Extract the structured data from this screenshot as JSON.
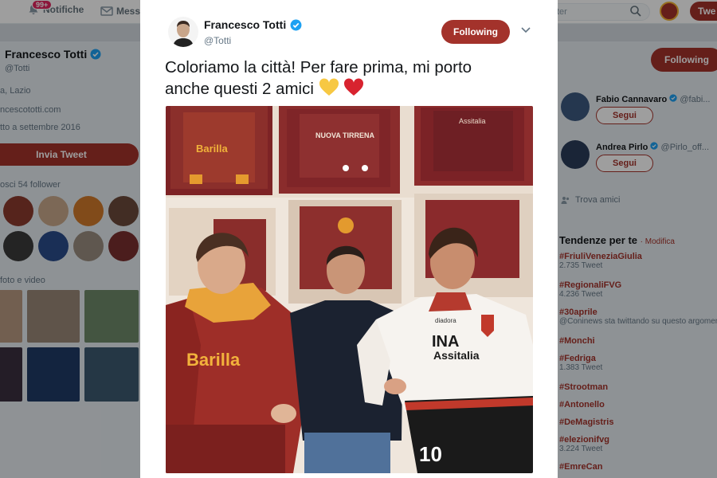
{
  "topbar": {
    "notifications_badge": "99+",
    "notifications_label": "Notifiche",
    "messages_label": "Messa",
    "search_placeholder": "ter",
    "tweet_button": "Twe"
  },
  "profile": {
    "name": "Francesco Totti",
    "handle": "@Totti",
    "location": "a, Lazio",
    "website": "ncescototti.com",
    "joined": "tto a settembre 2016",
    "tweet_button": "Invia Tweet",
    "followers_known": "osci 54 follower",
    "media_label": "foto e video",
    "follow_button": "Following"
  },
  "who_to_follow": [
    {
      "name": "Fabio Cannavaro",
      "handle": "@fabi...",
      "button": "Segui"
    },
    {
      "name": "Andrea Pirlo",
      "handle": "@Pirlo_off...",
      "button": "Segui"
    }
  ],
  "find_friends": "Trova amici",
  "trends": {
    "title": "Tendenze per te",
    "modify": "· Modifica",
    "items": [
      {
        "name": "#FriuliVeneziaGiulia",
        "count": "2.735 Tweet"
      },
      {
        "name": "#RegionaliFVG",
        "count": "4.236 Tweet"
      },
      {
        "name": "#30aprile",
        "count": "@Coninews sta twittando su questo argomento"
      },
      {
        "name": "#Monchi",
        "count": ""
      },
      {
        "name": "#Fedriga",
        "count": "1.383 Tweet"
      },
      {
        "name": "#Strootman",
        "count": ""
      },
      {
        "name": "#Antonello",
        "count": ""
      },
      {
        "name": "#DeMagistris",
        "count": ""
      },
      {
        "name": "#elezionifvg",
        "count": "3.224 Tweet"
      },
      {
        "name": "#EmreCan",
        "count": ""
      }
    ]
  },
  "tweet": {
    "author_name": "Francesco Totti",
    "author_handle": "@Totti",
    "follow_button": "Following",
    "text": "Coloriamo la città! Per fare prima, mi porto anche questi 2 amici",
    "photo_texts": {
      "barilla_1": "Barilla",
      "nuova_tirrena": "NUOVA TIRRENA",
      "assitalia_small": "Assitalia",
      "barilla_2": "Barilla",
      "ina": "INA",
      "assitalia": "Assitalia",
      "diadora": "diadora",
      "number": "10"
    }
  },
  "colors": {
    "accent": "#a3322b",
    "verified": "#1da1f2"
  }
}
